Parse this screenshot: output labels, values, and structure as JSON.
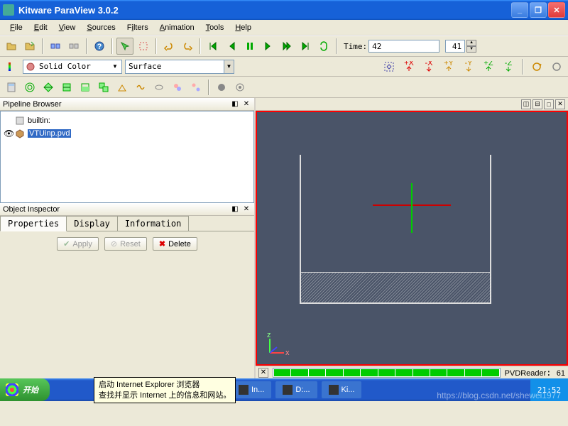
{
  "titlebar": {
    "text": "Kitware ParaView 3.0.2"
  },
  "menu": {
    "file": "File",
    "edit": "Edit",
    "view": "View",
    "sources": "Sources",
    "filters": "Filters",
    "animation": "Animation",
    "tools": "Tools",
    "help": "Help"
  },
  "time": {
    "label": "Time:",
    "value": "42",
    "frame": "41"
  },
  "color": {
    "mode": "Solid Color"
  },
  "representation": {
    "mode": "Surface"
  },
  "pipeline": {
    "title": "Pipeline Browser",
    "items": [
      {
        "name": "builtin:",
        "selected": false,
        "visible": false
      },
      {
        "name": "VTUinp.pvd",
        "selected": true,
        "visible": true
      }
    ]
  },
  "inspector": {
    "title": "Object Inspector",
    "tabs": {
      "props": "Properties",
      "display": "Display",
      "info": "Information"
    },
    "buttons": {
      "apply": "Apply",
      "reset": "Reset",
      "delete": "Delete"
    }
  },
  "progress": {
    "label": "PVDReader",
    "value": "61"
  },
  "taskbar": {
    "start": "开始",
    "tooltip_line1": "启动 Internet Explorer 浏览器",
    "tooltip_line2": "查找并显示 Internet 上的信息和网站。",
    "tasks": [
      {
        "label": "In..."
      },
      {
        "label": "D:..."
      },
      {
        "label": "Ki..."
      }
    ],
    "time": "21:52"
  },
  "watermark": "https://blog.csdn.net/shewei1977"
}
